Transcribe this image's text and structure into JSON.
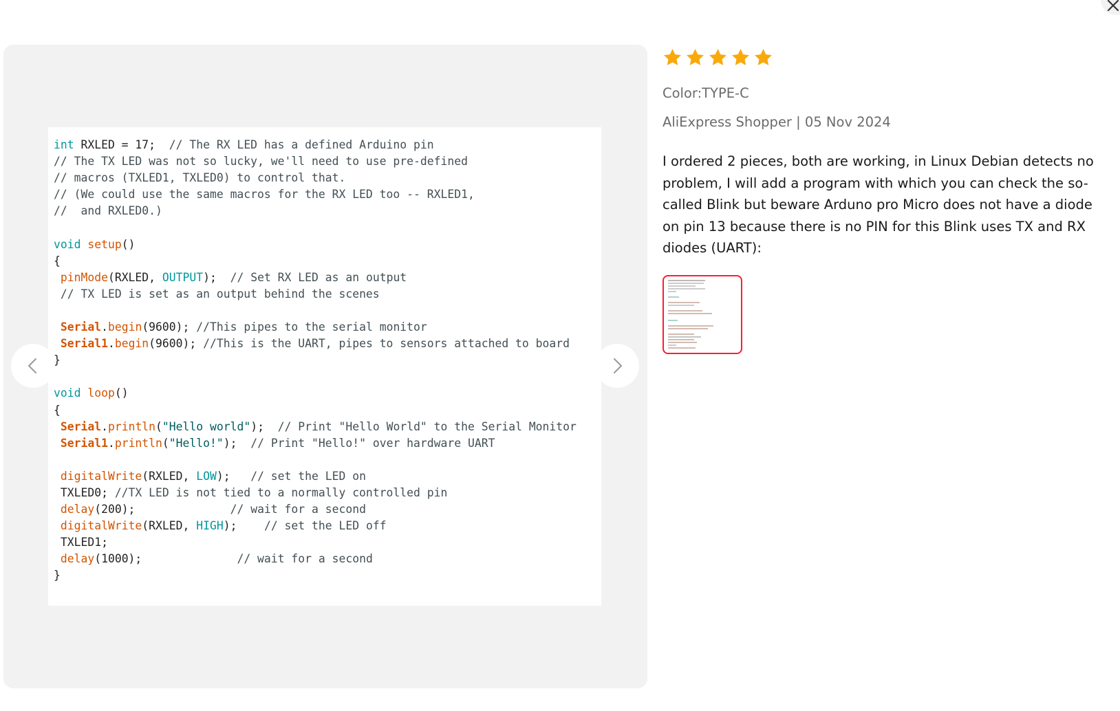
{
  "review": {
    "rating": 5,
    "rating_max": 5,
    "star_color": "#f9a90b",
    "color_label": "Color:TYPE-C",
    "author_date": "AliExpress Shopper | 05 Nov 2024",
    "text": "I ordered 2 pieces, both are working, in Linux Debian detects no problem, I will add a program with which you can check the so-called Blink but beware Arduno pro Micro does not have a diode on pin 13 because there is no PIN for this Blink uses TX and RX diodes (UART):",
    "thumbnail_border_color": "#ff1a35"
  },
  "code_lines": [
    [
      [
        "kw",
        "int"
      ],
      [
        "p",
        " RXLED = 17;  "
      ],
      [
        "cmt",
        "// The RX LED has a defined Arduino pin"
      ]
    ],
    [
      [
        "cmt",
        "// The TX LED was not so lucky, we'll need to use pre-defined"
      ]
    ],
    [
      [
        "cmt",
        "// macros (TXLED1, TXLED0) to control that."
      ]
    ],
    [
      [
        "cmt",
        "// (We could use the same macros for the RX LED too -- RXLED1,"
      ]
    ],
    [
      [
        "cmt",
        "//  and RXLED0.)"
      ]
    ],
    [],
    [
      [
        "kw",
        "void"
      ],
      [
        "p",
        " "
      ],
      [
        "fn",
        "setup"
      ],
      [
        "p",
        "()"
      ]
    ],
    [
      [
        "p",
        "{"
      ]
    ],
    [
      [
        "p",
        " "
      ],
      [
        "fn",
        "pinMode"
      ],
      [
        "p",
        "(RXLED, "
      ],
      [
        "const",
        "OUTPUT"
      ],
      [
        "p",
        ");  "
      ],
      [
        "cmt",
        "// Set RX LED as an output"
      ]
    ],
    [
      [
        "p",
        " "
      ],
      [
        "cmt",
        "// TX LED is set as an output behind the scenes"
      ]
    ],
    [],
    [
      [
        "p",
        " "
      ],
      [
        "obj",
        "Serial"
      ],
      [
        "p",
        "."
      ],
      [
        "fn",
        "begin"
      ],
      [
        "p",
        "(9600); "
      ],
      [
        "cmt",
        "//This pipes to the serial monitor"
      ]
    ],
    [
      [
        "p",
        " "
      ],
      [
        "obj",
        "Serial1"
      ],
      [
        "p",
        "."
      ],
      [
        "fn",
        "begin"
      ],
      [
        "p",
        "(9600); "
      ],
      [
        "cmt",
        "//This is the UART, pipes to sensors attached to board"
      ]
    ],
    [
      [
        "p",
        "}"
      ]
    ],
    [],
    [
      [
        "kw",
        "void"
      ],
      [
        "p",
        " "
      ],
      [
        "fn",
        "loop"
      ],
      [
        "p",
        "()"
      ]
    ],
    [
      [
        "p",
        "{"
      ]
    ],
    [
      [
        "p",
        " "
      ],
      [
        "obj",
        "Serial"
      ],
      [
        "p",
        "."
      ],
      [
        "fn",
        "println"
      ],
      [
        "p",
        "("
      ],
      [
        "str",
        "\"Hello world\""
      ],
      [
        "p",
        ");  "
      ],
      [
        "cmt",
        "// Print \"Hello World\" to the Serial Monitor"
      ]
    ],
    [
      [
        "p",
        " "
      ],
      [
        "obj",
        "Serial1"
      ],
      [
        "p",
        "."
      ],
      [
        "fn",
        "println"
      ],
      [
        "p",
        "("
      ],
      [
        "str",
        "\"Hello!\""
      ],
      [
        "p",
        ");  "
      ],
      [
        "cmt",
        "// Print \"Hello!\" over hardware UART"
      ]
    ],
    [],
    [
      [
        "p",
        " "
      ],
      [
        "fn",
        "digitalWrite"
      ],
      [
        "p",
        "(RXLED, "
      ],
      [
        "const",
        "LOW"
      ],
      [
        "p",
        ");   "
      ],
      [
        "cmt",
        "// set the LED on"
      ]
    ],
    [
      [
        "p",
        " TXLED0; "
      ],
      [
        "cmt",
        "//TX LED is not tied to a normally controlled pin"
      ]
    ],
    [
      [
        "p",
        " "
      ],
      [
        "fn",
        "delay"
      ],
      [
        "p",
        "(200);              "
      ],
      [
        "cmt",
        "// wait for a second"
      ]
    ],
    [
      [
        "p",
        " "
      ],
      [
        "fn",
        "digitalWrite"
      ],
      [
        "p",
        "(RXLED, "
      ],
      [
        "const",
        "HIGH"
      ],
      [
        "p",
        ");    "
      ],
      [
        "cmt",
        "// set the LED off"
      ]
    ],
    [
      [
        "p",
        " TXLED1;"
      ]
    ],
    [
      [
        "p",
        " "
      ],
      [
        "fn",
        "delay"
      ],
      [
        "p",
        "(1000);              "
      ],
      [
        "cmt",
        "// wait for a second"
      ]
    ],
    [
      [
        "p",
        "}"
      ]
    ]
  ]
}
